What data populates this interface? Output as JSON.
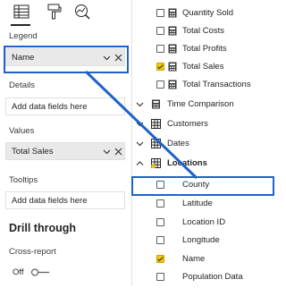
{
  "visual_tabs": [
    {
      "icon": "fields-icon",
      "active": true
    },
    {
      "icon": "format-paint-icon",
      "active": false
    },
    {
      "icon": "analytics-icon",
      "active": false
    }
  ],
  "left": {
    "legend": {
      "label": "Legend",
      "value": "Name"
    },
    "details": {
      "label": "Details",
      "placeholder": "Add data fields here"
    },
    "values": {
      "label": "Values",
      "value": "Total Sales"
    },
    "tooltips": {
      "label": "Tooltips",
      "placeholder": "Add data fields here"
    },
    "drill_through": {
      "title": "Drill through",
      "cross_report_label": "Cross-report",
      "toggle_state": "Off"
    }
  },
  "fields": {
    "measures": [
      {
        "label": "Quantity Sold",
        "checked": false
      },
      {
        "label": "Total Costs",
        "checked": false
      },
      {
        "label": "Total Profits",
        "checked": false
      },
      {
        "label": "Total Sales",
        "checked": true
      },
      {
        "label": "Total Transactions",
        "checked": false
      }
    ],
    "tables": [
      {
        "label": "Time Comparison",
        "icon": "calculator-icon",
        "expanded": false
      },
      {
        "label": "Customers",
        "icon": "table-icon",
        "expanded": false
      },
      {
        "label": "Dates",
        "icon": "table-icon",
        "expanded": false
      },
      {
        "label": "Locations",
        "icon": "table-icon",
        "expanded": true,
        "has_checked": true
      }
    ],
    "location_columns": [
      {
        "label": "County",
        "checked": false
      },
      {
        "label": "Latitude",
        "checked": false
      },
      {
        "label": "Location ID",
        "checked": false
      },
      {
        "label": "Longitude",
        "checked": false
      },
      {
        "label": "Name",
        "checked": true
      },
      {
        "label": "Population Data",
        "checked": false
      }
    ]
  },
  "colors": {
    "highlight": "#1f63c6",
    "checkbox_checked": "#f2c811",
    "well_filled": "#e9e9e9"
  }
}
